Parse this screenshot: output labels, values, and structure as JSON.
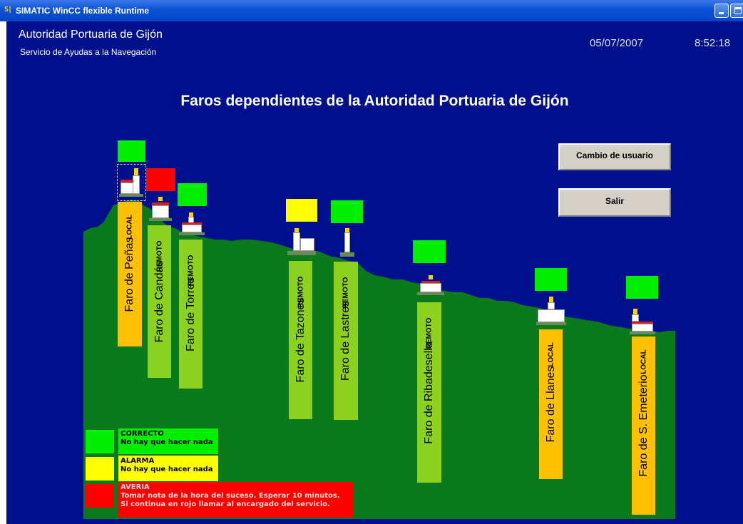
{
  "window": {
    "title": "SIMATIC WinCC flexible Runtime",
    "icon": "app-logo-icon"
  },
  "header": {
    "organization": "Autoridad Portuaria de Gijón",
    "service": "Servicio de Ayudas a la Navegación",
    "date": "05/07/2007",
    "time": "8:52:18"
  },
  "main_title": "Faros dependientes de la Autoridad Portuaria de Gijón",
  "buttons": {
    "change_user": "Cambio de usuario",
    "exit": "Salir"
  },
  "colors": {
    "background": "#000f8c",
    "terrain": "#0a7a1a",
    "ok": "#00ee00",
    "alarm": "#ffff00",
    "fault": "#ff0000",
    "local_label": "#ffc000",
    "remote_label": "#8cd020"
  },
  "lighthouses": [
    {
      "name": "Faro de Peñas",
      "mode": "LOCAL",
      "status": "ok"
    },
    {
      "name": "Faro de Candás",
      "mode": "REMOTO",
      "status": "fault"
    },
    {
      "name": "Faro de Torres",
      "mode": "REMOTO",
      "status": "ok"
    },
    {
      "name": "Faro de Tazones",
      "mode": "REMOTO",
      "status": "alarm"
    },
    {
      "name": "Faro de Lastres",
      "mode": "REMOTO",
      "status": "ok"
    },
    {
      "name": "Faro de Ribadesella",
      "mode": "REMOTO",
      "status": "ok"
    },
    {
      "name": "Faro de Llanes",
      "mode": "LOCAL",
      "status": "ok"
    },
    {
      "name": "Faro de S. Emeterio",
      "mode": "LOCAL",
      "status": "ok"
    }
  ],
  "legend": [
    {
      "status": "ok",
      "title": "CORRECTO",
      "lines": [
        "No hay que hacer nada"
      ]
    },
    {
      "status": "alarm",
      "title": "ALARMA",
      "lines": [
        "No hay que hacer nada"
      ]
    },
    {
      "status": "fault",
      "title": "AVERIA",
      "lines": [
        "Tomar nota de la hora del suceso. Esperar 10 minutos.",
        "Si continua en rojo llamar al encargado del servicio."
      ]
    }
  ]
}
